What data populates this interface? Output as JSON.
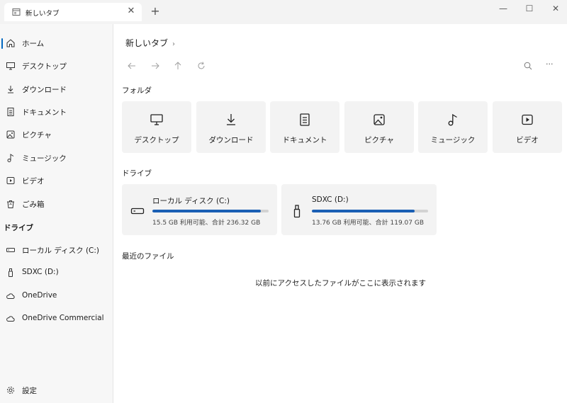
{
  "tab": {
    "title": "新しいタブ",
    "close_glyph": "✕"
  },
  "window": {
    "new_tab_glyph": "+",
    "minimize_glyph": "—",
    "maximize_glyph": "☐",
    "close_glyph": "✕"
  },
  "sidebar": {
    "items": [
      {
        "label": "ホーム",
        "icon": "home-icon"
      },
      {
        "label": "デスクトップ",
        "icon": "desktop-icon"
      },
      {
        "label": "ダウンロード",
        "icon": "download-icon"
      },
      {
        "label": "ドキュメント",
        "icon": "document-icon"
      },
      {
        "label": "ピクチャ",
        "icon": "picture-icon"
      },
      {
        "label": "ミュージック",
        "icon": "music-icon"
      },
      {
        "label": "ビデオ",
        "icon": "video-icon"
      },
      {
        "label": "ごみ箱",
        "icon": "recycle-bin-icon"
      }
    ],
    "drive_section": "ドライブ",
    "drives": [
      {
        "label": "ローカル ディスク (C:)",
        "icon": "hard-drive-icon"
      },
      {
        "label": "SDXC (D:)",
        "icon": "usb-drive-icon"
      },
      {
        "label": "OneDrive",
        "icon": "cloud-icon"
      },
      {
        "label": "OneDrive Commercial",
        "icon": "cloud-icon"
      }
    ],
    "settings": "設定"
  },
  "main": {
    "breadcrumb": "新しいタブ",
    "breadcrumb_chevron": "›",
    "more_glyph": "···",
    "folders_title": "フォルダ",
    "folders": [
      {
        "label": "デスクトップ",
        "icon": "desktop-icon"
      },
      {
        "label": "ダウンロード",
        "icon": "download-icon"
      },
      {
        "label": "ドキュメント",
        "icon": "document-icon"
      },
      {
        "label": "ピクチャ",
        "icon": "picture-icon"
      },
      {
        "label": "ミュージック",
        "icon": "music-icon"
      },
      {
        "label": "ビデオ",
        "icon": "video-icon"
      }
    ],
    "drives_title": "ドライブ",
    "drive_cards": [
      {
        "name": "ローカル ディスク (C:)",
        "usage": "15.5 GB 利用可能、合計 236.32 GB",
        "used_fraction": 0.934
      },
      {
        "name": "SDXC (D:)",
        "usage": "13.76 GB 利用可能、合計 119.07 GB",
        "used_fraction": 0.884
      }
    ],
    "recent_title": "最近のファイル",
    "empty_message": "以前にアクセスしたファイルがここに表示されます"
  },
  "colors": {
    "accent": "#0067c0",
    "bar_fill": "#1a5fb4",
    "card_bg": "#f3f3f3"
  }
}
